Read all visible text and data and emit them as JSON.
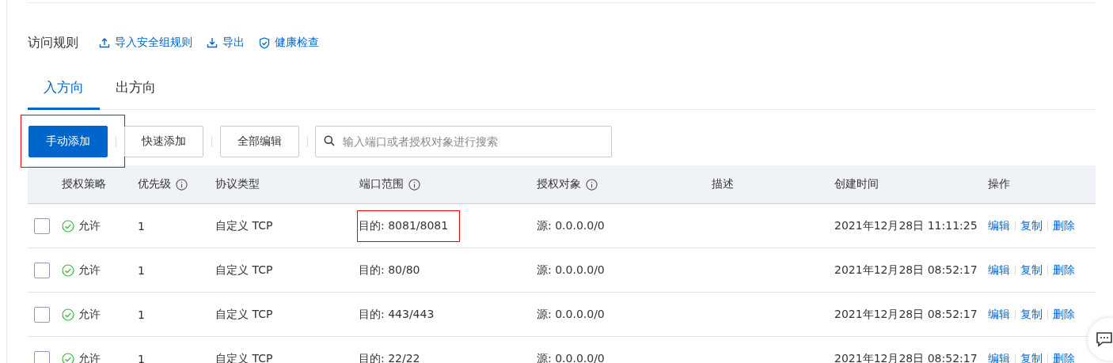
{
  "section": {
    "title": "访问规则",
    "actions": [
      {
        "kind": "upload",
        "label": "导入安全组规则"
      },
      {
        "kind": "download",
        "label": "导出"
      },
      {
        "kind": "shield",
        "label": "健康检查"
      }
    ]
  },
  "tabs": [
    {
      "label": "入方向",
      "selected": true
    },
    {
      "label": "出方向",
      "selected": false
    }
  ],
  "toolbar": {
    "buttons": [
      {
        "label": "手动添加",
        "primary": true,
        "highlighted": true
      },
      {
        "label": "快速添加",
        "primary": false,
        "highlighted": false
      },
      {
        "label": "全部编辑",
        "primary": false,
        "highlighted": false
      }
    ],
    "search": {
      "placeholder": "输入端口或者授权对象进行搜索"
    }
  },
  "table": {
    "columns": [
      {
        "label": "授权策略",
        "info": false
      },
      {
        "label": "优先级",
        "info": true
      },
      {
        "label": "协议类型",
        "info": false
      },
      {
        "label": "端口范围",
        "info": true
      },
      {
        "label": "授权对象",
        "info": true
      },
      {
        "label": "描述",
        "info": false
      },
      {
        "label": "创建时间",
        "info": false
      },
      {
        "label": "操作",
        "info": false
      }
    ],
    "rows": [
      {
        "checked": false,
        "policy": "允许",
        "priority": "1",
        "protocol": "自定义 TCP",
        "port": "目的: 8081/8081",
        "port_highlighted": true,
        "target": "源: 0.0.0.0/0",
        "description": "",
        "created": "2021年12月28日 11:11:25",
        "actions": [
          "编辑",
          "复制",
          "删除"
        ]
      },
      {
        "checked": false,
        "policy": "允许",
        "priority": "1",
        "protocol": "自定义 TCP",
        "port": "目的: 80/80",
        "port_highlighted": false,
        "target": "源: 0.0.0.0/0",
        "description": "",
        "created": "2021年12月28日 08:52:17",
        "actions": [
          "编辑",
          "复制",
          "删除"
        ]
      },
      {
        "checked": false,
        "policy": "允许",
        "priority": "1",
        "protocol": "自定义 TCP",
        "port": "目的: 443/443",
        "port_highlighted": false,
        "target": "源: 0.0.0.0/0",
        "description": "",
        "created": "2021年12月28日 08:52:17",
        "actions": [
          "编辑",
          "复制",
          "删除"
        ]
      },
      {
        "checked": false,
        "policy": "允许",
        "priority": "1",
        "protocol": "自定义 TCP",
        "port": "目的: 22/22",
        "port_highlighted": false,
        "target": "源: 0.0.0.0/0",
        "description": "",
        "created": "2021年12月28日 08:52:17",
        "actions": [
          "编辑",
          "复制",
          "删除"
        ]
      }
    ]
  }
}
